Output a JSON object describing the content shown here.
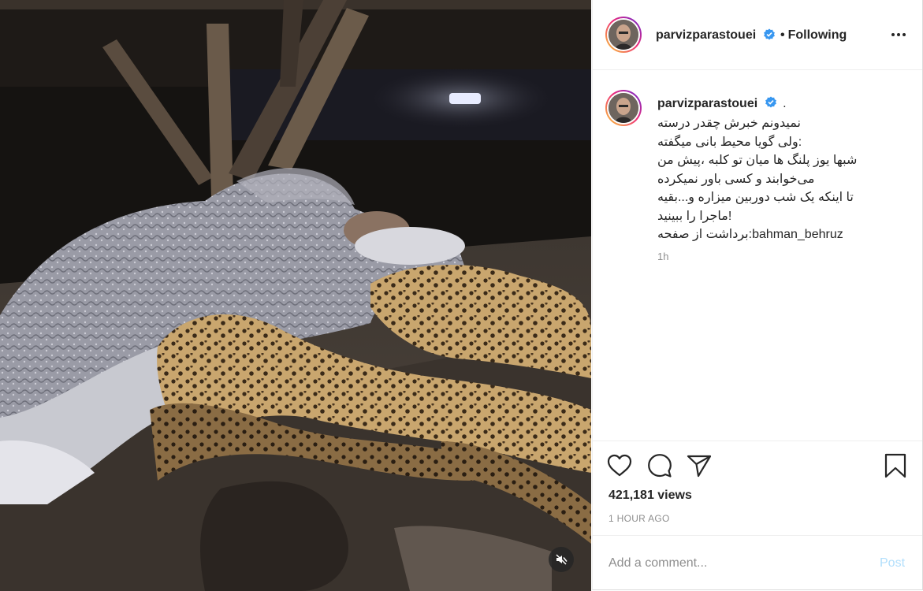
{
  "post": {
    "username": "parvizparastouei",
    "follow_status": "Following",
    "caption_suffix": ".",
    "caption_lines": [
      "نمیدونم خبرش چقدر درسته",
      "ولی گویا محیط بانی میگفته:",
      "شبها یوز پلنگ ها میان تو کلبه ،پیش من",
      "می‌خوابند و کسی باور نمیکرده",
      "تا اینکه یک شب دوربین میزاره و...بقیه",
      "ماجرا را ببینید!",
      "برداشت از صفحه:bahman_behruz"
    ],
    "caption_time": "1h",
    "views": "421,181 views",
    "time_ago": "1 HOUR AGO"
  },
  "comment": {
    "placeholder": "Add a comment...",
    "post_label": "Post"
  },
  "colors": {
    "verified": "#3897f0",
    "post_disabled": "#b2dffc",
    "muted_text": "#8e8e8e"
  },
  "icons": {
    "like": "heart-icon",
    "comment": "comment-icon",
    "share": "paper-plane-icon",
    "save": "bookmark-icon",
    "more": "more-options-icon",
    "mute": "speaker-muted-icon",
    "verified": "verified-badge-icon"
  }
}
